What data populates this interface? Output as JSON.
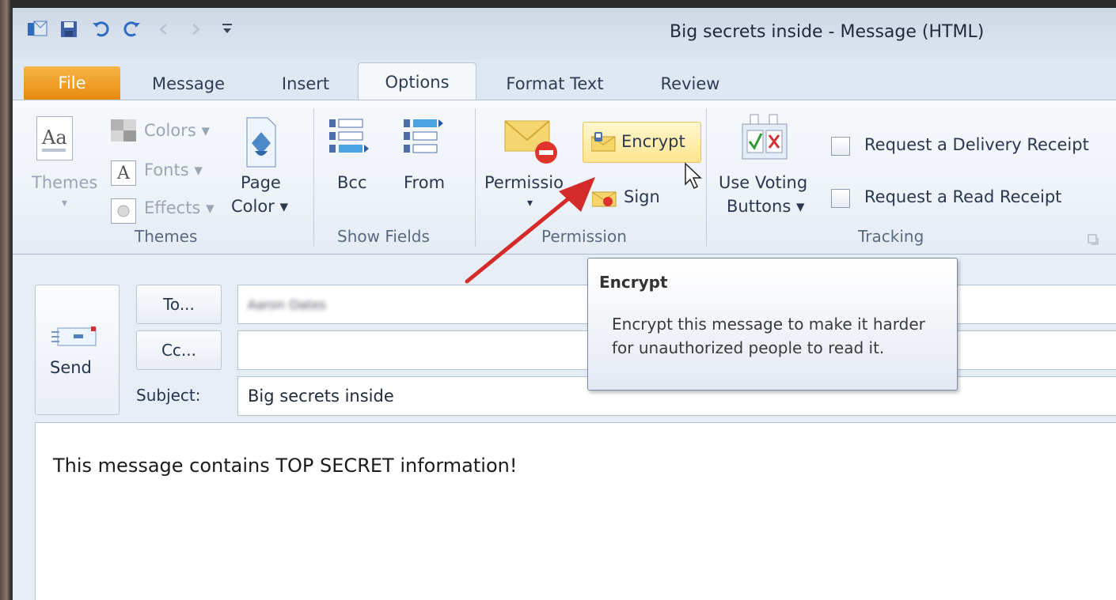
{
  "window": {
    "title": "Big secrets inside  -  Message (HTML)"
  },
  "qat": {
    "icons": [
      "outlook-icon",
      "save-icon",
      "undo-icon",
      "redo-icon",
      "back-icon",
      "forward-icon",
      "customize-icon"
    ]
  },
  "tabs": [
    {
      "label": "File"
    },
    {
      "label": "Message"
    },
    {
      "label": "Insert"
    },
    {
      "label": "Options"
    },
    {
      "label": "Format Text"
    },
    {
      "label": "Review"
    }
  ],
  "ribbon": {
    "themes": {
      "themes_label": "Themes",
      "colors_label": "Colors",
      "fonts_label": "Fonts",
      "effects_label": "Effects",
      "page_color_line1": "Page",
      "page_color_line2": "Color",
      "group_label": "Themes"
    },
    "show_fields": {
      "bcc_label": "Bcc",
      "from_label": "From",
      "group_label": "Show Fields"
    },
    "permission": {
      "permission_label": "Permissio",
      "encrypt_label": "Encrypt",
      "sign_label": "Sign",
      "group_label": "Permission"
    },
    "tracking": {
      "voting_line1": "Use Voting",
      "voting_line2": "Buttons",
      "delivery_receipt_label": "Request a Delivery Receipt",
      "read_receipt_label": "Request a Read Receipt",
      "group_label": "Tracking"
    }
  },
  "compose": {
    "send_label": "Send",
    "to_button": "To...",
    "cc_button": "Cc...",
    "subject_label": "Subject:",
    "to_value": "Aaron Oates",
    "cc_value": "",
    "subject_value": "Big secrets inside",
    "body_text": "This message contains TOP SECRET information!"
  },
  "tooltip": {
    "title": "Encrypt",
    "body": "Encrypt this message to make it harder for unauthorized people to read it."
  },
  "colors": {
    "file_tab": "#e88a10",
    "arrow": "#d42a2a",
    "highlight": "#ffe58f"
  }
}
